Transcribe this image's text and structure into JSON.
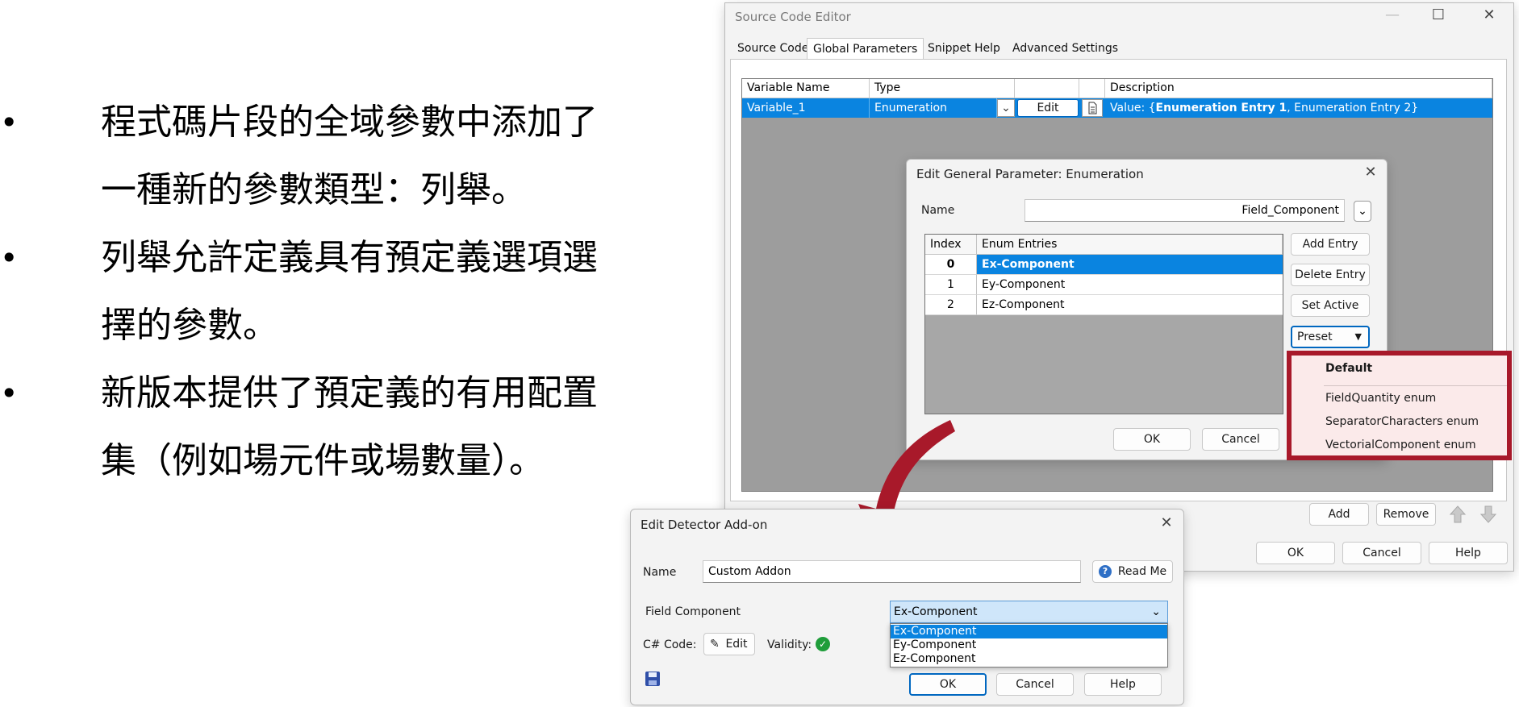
{
  "slide": {
    "bullet_char": "•",
    "bullets": [
      [
        "程式碼片段的全域參數中添加了",
        "一種新的參數類型：列舉。"
      ],
      [
        "列舉允許定義具有預定義選項選",
        "擇的參數。"
      ],
      [
        "新版本提供了預定義的有用配置",
        "集（例如場元件或場數量）。"
      ]
    ]
  },
  "source_editor": {
    "title": "Source Code Editor",
    "tabs": [
      "Source Code",
      "Global Parameters",
      "Snippet Help",
      "Advanced Settings"
    ],
    "active_tab": 1,
    "columns": [
      "Variable Name",
      "Type",
      "",
      "",
      "Description"
    ],
    "row": {
      "name": "Variable_1",
      "type": "Enumeration",
      "edit_label": "Edit",
      "desc_prefix": "Value: {",
      "desc_bold": "Enumeration Entry 1",
      "desc_suffix": ", Enumeration Entry 2}"
    },
    "add_label": "Add",
    "remove_label": "Remove",
    "ok_label": "OK",
    "cancel_label": "Cancel",
    "help_label": "Help"
  },
  "enum_dialog": {
    "title": "Edit General Parameter: Enumeration",
    "name_label": "Name",
    "name_value": "Field_Component",
    "columns": [
      "Index",
      "Enum Entries"
    ],
    "entries": [
      {
        "index": "0",
        "value": "Ex-Component"
      },
      {
        "index": "1",
        "value": "Ey-Component"
      },
      {
        "index": "2",
        "value": "Ez-Component"
      }
    ],
    "add_entry": "Add Entry",
    "delete_entry": "Delete Entry",
    "set_active": "Set Active",
    "preset": "Preset",
    "ok_label": "OK",
    "cancel_label": "Cancel"
  },
  "preset_menu": {
    "items": [
      "Default",
      "FieldQuantity enum",
      "SeparatorCharacters enum",
      "VectorialComponent enum"
    ]
  },
  "detector_dialog": {
    "title": "Edit Detector Add-on",
    "name_label": "Name",
    "name_value": "Custom  Addon",
    "read_me": "Read Me",
    "field_label": "Field Component",
    "field_value": "Ex-Component",
    "options": [
      "Ex-Component",
      "Ey-Component",
      "Ez-Component"
    ],
    "code_label": "C# Code:",
    "edit_label": "Edit",
    "validity_label": "Validity:",
    "ok_label": "OK",
    "cancel_label": "Cancel",
    "help_label": "Help"
  },
  "colors": {
    "selection": "#0a84e0",
    "highlight_border": "#a8192a",
    "arrow": "#a8192a",
    "valid": "#1f9d3a"
  }
}
